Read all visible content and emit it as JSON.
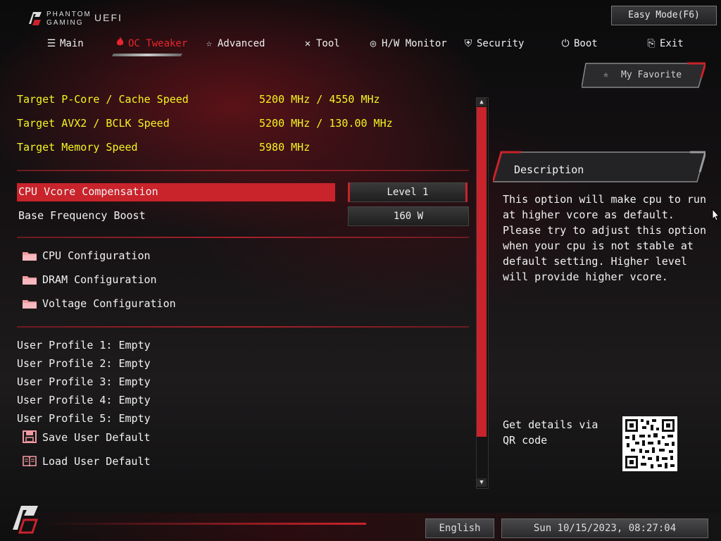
{
  "brand": {
    "line1": "PHANTOM",
    "line2": "GAMING",
    "product": "UEFI"
  },
  "header": {
    "easy_mode": "Easy Mode(F6)"
  },
  "tabs": [
    {
      "label": "Main",
      "icon": "list-icon"
    },
    {
      "label": "OC Tweaker",
      "icon": "flame-icon",
      "active": true
    },
    {
      "label": "Advanced",
      "icon": "star-icon"
    },
    {
      "label": "Tool",
      "icon": "tools-icon"
    },
    {
      "label": "H/W Monitor",
      "icon": "globe-icon"
    },
    {
      "label": "Security",
      "icon": "shield-icon"
    },
    {
      "label": "Boot",
      "icon": "power-icon"
    },
    {
      "label": "Exit",
      "icon": "exit-icon"
    }
  ],
  "favorite": {
    "label": "My Favorite"
  },
  "targets": [
    {
      "label": "Target P-Core / Cache Speed",
      "value": "5200 MHz / 4550 MHz"
    },
    {
      "label": "Target AVX2 / BCLK Speed",
      "value": "5200 MHz / 130.00 MHz"
    },
    {
      "label": "Target Memory Speed",
      "value": "5980 MHz"
    }
  ],
  "settings": [
    {
      "label": "CPU Vcore Compensation",
      "value": "Level 1",
      "selected": true
    },
    {
      "label": "Base Frequency Boost",
      "value": "160 W"
    }
  ],
  "submenus": [
    "CPU Configuration",
    "DRAM Configuration",
    "Voltage Configuration"
  ],
  "profiles": [
    "User Profile 1: Empty",
    "User Profile 2: Empty",
    "User Profile 3: Empty",
    "User Profile 4: Empty",
    "User Profile 5: Empty"
  ],
  "actions": [
    {
      "label": "Save User Default",
      "icon": "floppy-disk-icon"
    },
    {
      "label": "Load User Default",
      "icon": "open-book-icon"
    }
  ],
  "description": {
    "title": "Description",
    "text": "This option will make cpu to run\nat higher vcore as default.\nPlease try to adjust this option\nwhen your cpu is not stable at\ndefault setting. Higher level\nwill provide higher vcore."
  },
  "qr": {
    "label": "Get details via QR code"
  },
  "footer": {
    "language": "English",
    "datetime": "Sun 10/15/2023, 08:27:04"
  },
  "colors": {
    "accent": "#c9232b",
    "active_tab": "#e8262d",
    "highlight_text": "#f5f520"
  }
}
